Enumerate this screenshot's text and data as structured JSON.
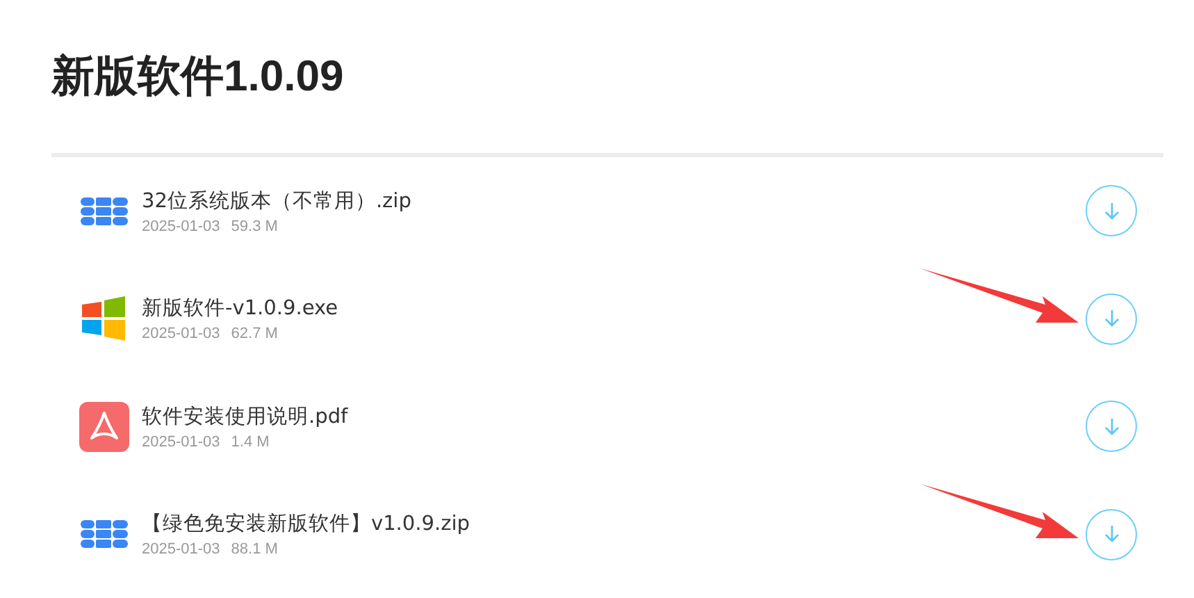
{
  "title": "新版软件1.0.09",
  "files": [
    {
      "kind": "archive",
      "name": "32位系统版本（不常用）.zip",
      "date": "2025-01-03",
      "size": "59.3 M",
      "arrow": false
    },
    {
      "kind": "windows",
      "name": "新版软件-v1.0.9.exe",
      "date": "2025-01-03",
      "size": "62.7 M",
      "arrow": true
    },
    {
      "kind": "pdf",
      "name": "软件安装使用说明.pdf",
      "date": "2025-01-03",
      "size": "1.4 M",
      "arrow": false
    },
    {
      "kind": "archive",
      "name": "【绿色免安装新版软件】v1.0.9.zip",
      "date": "2025-01-03",
      "size": "88.1 M",
      "arrow": true
    }
  ]
}
